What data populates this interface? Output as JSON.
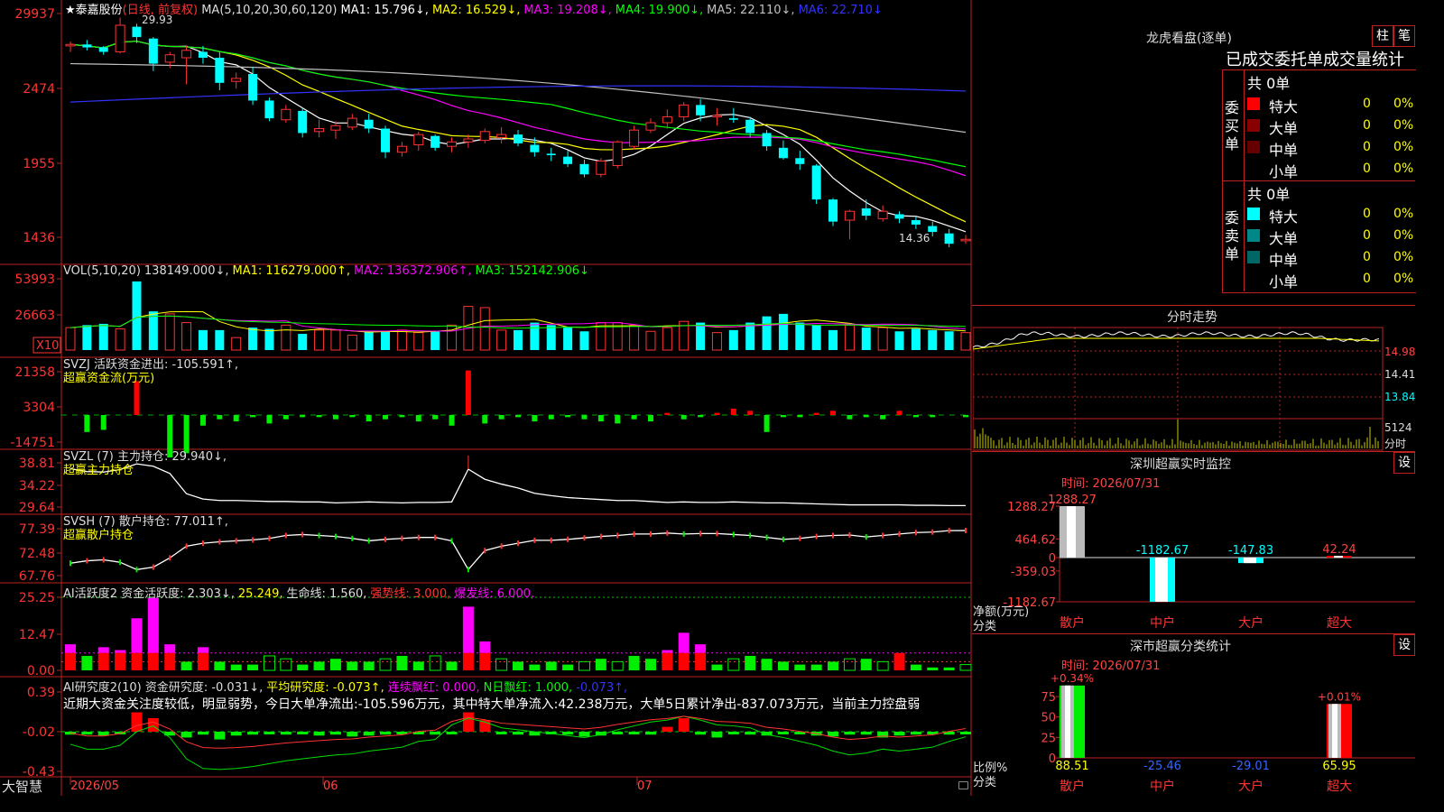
{
  "app": {
    "brand": "大智慧"
  },
  "stock": {
    "title": "★泰嘉股份",
    "mode": "(日线, 前复权)",
    "high_mark": "29.93",
    "low_mark": "14.36"
  },
  "ma_legend": {
    "label": "MA(5,10,20,30,60,120)",
    "items": [
      {
        "text": "MA1: 15.796↓,",
        "color": "#ffffff"
      },
      {
        "text": "MA2: 16.529↓,",
        "color": "#ffff00"
      },
      {
        "text": "MA3: 19.208↓,",
        "color": "#ff00ff"
      },
      {
        "text": "MA4: 19.900↓,",
        "color": "#00ff00"
      },
      {
        "text": "MA5: 22.110↓,",
        "color": "#c0c0c0"
      },
      {
        "text": "MA6: 22.710↓",
        "color": "#3333ff"
      }
    ]
  },
  "price_axis": [
    "29937",
    "2474",
    "1955",
    "1436"
  ],
  "vol": {
    "axis": [
      "53993",
      "26663",
      "X10"
    ],
    "legend": [
      {
        "text": "VOL(5,10,20)",
        "color": "#dddddd"
      },
      {
        "text": "138149.000↓,",
        "color": "#dddddd"
      },
      {
        "text": "MA1: 116279.000↑,",
        "color": "#ffff00"
      },
      {
        "text": "MA2: 136372.906↑,",
        "color": "#ff00ff"
      },
      {
        "text": "MA3: 152142.906↓",
        "color": "#00ff00"
      }
    ]
  },
  "svzj": {
    "axis": [
      "21358",
      "3304",
      "-14751"
    ],
    "line1": "SVZJ  活跃资金进出: -105.591↑,",
    "line2": "超赢资金流(万元)"
  },
  "svzl": {
    "axis": [
      "38.81",
      "34.22",
      "29.64"
    ],
    "line1": "SVZL (7) 主力持仓: 29.940↓,",
    "line2": "超赢主力持仓"
  },
  "svsh": {
    "axis": [
      "77.39",
      "72.48",
      "67.76"
    ],
    "line1": "SVSH (7) 散户持仓: 77.011↑,",
    "line2": "超赢散户持仓"
  },
  "ai_active": {
    "axis": [
      "25.25",
      "12.47",
      "0.00"
    ],
    "legend": [
      {
        "text": "AI活跃度2 资金活跃度: 2.303↓,",
        "color": "#dddddd"
      },
      {
        "text": "25.249,",
        "color": "#ffff00"
      },
      {
        "text": "生命线: 1.560,",
        "color": "#dddddd"
      },
      {
        "text": "强势线: 3.000,",
        "color": "#ff3333"
      },
      {
        "text": "爆发线: 6.000,",
        "color": "#ff00ff"
      }
    ]
  },
  "ai_research": {
    "axis": [
      "0.39",
      "-0.02",
      "-0.43"
    ],
    "legend": [
      {
        "text": "AI研究度2(10) 资金研究度: -0.031↓,",
        "color": "#dddddd"
      },
      {
        "text": "平均研究度: -0.073↑,",
        "color": "#ffff00"
      },
      {
        "text": "连续飘红: 0.000,",
        "color": "#ff00ff"
      },
      {
        "text": "N日飘红: 1.000,",
        "color": "#00ff00"
      },
      {
        "text": "-0.073↑,",
        "color": "#3333ff"
      }
    ],
    "commentary": "近期大资金关注度较低，明显弱势，今日大单净流出:-105.596万元，其中特大单净流入:42.238万元，大单5日累计净出-837.073万元，当前主力控盘弱"
  },
  "time_axis": [
    "2026/05",
    "06",
    "07"
  ],
  "dragon": {
    "title": "龙虎看盘(逐单)",
    "btn_column": "柱",
    "btn_grid": "笔",
    "stats_header": "已成交委托单成交量统计",
    "buy": {
      "side": "委买单",
      "total": "共 0单",
      "rows": [
        {
          "label": "特大",
          "count": "0",
          "pct": "0%",
          "color": "#ff0000"
        },
        {
          "label": "大单",
          "count": "0",
          "pct": "0%",
          "color": "#880000"
        },
        {
          "label": "中单",
          "count": "0",
          "pct": "0%",
          "color": "#660000"
        },
        {
          "label": "小单",
          "count": "0",
          "pct": "0%",
          "color": "#000000"
        }
      ]
    },
    "sell": {
      "side": "委卖单",
      "total": "共 0单",
      "rows": [
        {
          "label": "特大",
          "count": "0",
          "pct": "0%",
          "color": "#00ffff"
        },
        {
          "label": "大单",
          "count": "0",
          "pct": "0%",
          "color": "#008888"
        },
        {
          "label": "中单",
          "count": "0",
          "pct": "0%",
          "color": "#006666"
        },
        {
          "label": "小单",
          "count": "0",
          "pct": "0%",
          "color": "#000000"
        }
      ]
    }
  },
  "intraday": {
    "title": "分时走势",
    "price_labels": [
      "14.98",
      "14.41",
      "13.84"
    ],
    "vol_label": "5124",
    "vol_unit": "分时"
  },
  "sz_monitor": {
    "title": "深圳超赢实时监控",
    "btn": "设",
    "time": "时间: 2026/07/31",
    "yaxis": [
      "1288.27",
      "464.62",
      "0",
      "-359.03",
      "-1182.67"
    ],
    "unit": "净额(万元)",
    "category_label": "分类",
    "categories": [
      "散户",
      "中户",
      "大户",
      "超大"
    ],
    "value_labels": [
      "1288.27",
      "-1182.67",
      "-147.83",
      "42.24"
    ]
  },
  "sz_class": {
    "title": "深市超赢分类统计",
    "btn": "设",
    "time": "时间: 2026/07/31",
    "yaxis": [
      "75",
      "50",
      "25",
      "0"
    ],
    "unit": "比例%",
    "category_label": "分类",
    "categories": [
      "散户",
      "中户",
      "大户",
      "超大"
    ],
    "top_labels": [
      "+0.34%",
      "",
      "",
      "+0.01%"
    ],
    "bottom_labels": [
      "88.51",
      "-25.46",
      "-29.01",
      "65.95"
    ]
  },
  "chart_data": [
    {
      "type": "candlestick",
      "title": "泰嘉股份 (日线, 前复权)",
      "x_months": [
        "2026/05",
        "06",
        "07"
      ],
      "ylim": [
        14.0,
        30.5
      ],
      "candles": [
        [
          28.0,
          28.3,
          27.6,
          28.1
        ],
        [
          28.1,
          28.4,
          27.7,
          27.9
        ],
        [
          27.9,
          28.0,
          27.4,
          27.6
        ],
        [
          27.6,
          29.93,
          27.5,
          29.4
        ],
        [
          29.3,
          29.5,
          28.2,
          28.6
        ],
        [
          28.5,
          28.6,
          26.3,
          26.8
        ],
        [
          26.9,
          27.6,
          26.5,
          27.4
        ],
        [
          27.2,
          28.0,
          25.4,
          27.7
        ],
        [
          27.6,
          28.0,
          26.8,
          27.2
        ],
        [
          27.2,
          27.6,
          25.0,
          25.5
        ],
        [
          25.6,
          26.2,
          25.1,
          25.8
        ],
        [
          26.1,
          26.6,
          24.0,
          24.3
        ],
        [
          24.3,
          24.5,
          22.9,
          23.1
        ],
        [
          23.0,
          24.0,
          22.8,
          23.7
        ],
        [
          23.6,
          23.8,
          21.8,
          22.1
        ],
        [
          22.2,
          23.0,
          21.8,
          22.4
        ],
        [
          22.3,
          22.9,
          21.7,
          22.6
        ],
        [
          22.5,
          23.4,
          22.3,
          23.1
        ],
        [
          23.0,
          23.4,
          22.1,
          22.4
        ],
        [
          22.4,
          22.6,
          20.4,
          20.8
        ],
        [
          20.8,
          21.5,
          20.5,
          21.2
        ],
        [
          21.3,
          22.2,
          20.9,
          22.0
        ],
        [
          21.9,
          22.0,
          20.9,
          21.1
        ],
        [
          21.2,
          21.8,
          20.8,
          21.5
        ],
        [
          21.5,
          22.0,
          21.1,
          21.7
        ],
        [
          21.6,
          22.4,
          21.4,
          22.2
        ],
        [
          21.8,
          22.5,
          21.4,
          22.0
        ],
        [
          22.0,
          22.3,
          21.2,
          21.4
        ],
        [
          21.3,
          21.8,
          20.5,
          20.8
        ],
        [
          20.7,
          21.1,
          20.2,
          20.6
        ],
        [
          20.5,
          20.9,
          19.8,
          20.0
        ],
        [
          20.0,
          20.3,
          19.1,
          19.3
        ],
        [
          19.3,
          20.4,
          19.1,
          20.2
        ],
        [
          19.9,
          21.6,
          19.7,
          21.5
        ],
        [
          21.2,
          22.6,
          21.0,
          22.3
        ],
        [
          22.3,
          23.1,
          22.1,
          22.8
        ],
        [
          22.8,
          23.7,
          22.4,
          23.2
        ],
        [
          23.2,
          24.2,
          22.9,
          24.0
        ],
        [
          24.0,
          24.4,
          22.9,
          23.3
        ],
        [
          23.2,
          23.8,
          22.6,
          23.3
        ],
        [
          23.1,
          23.8,
          22.8,
          23.0
        ],
        [
          23.0,
          23.2,
          21.8,
          22.1
        ],
        [
          22.1,
          22.3,
          20.9,
          21.2
        ],
        [
          21.1,
          21.6,
          20.3,
          20.4
        ],
        [
          20.4,
          20.9,
          19.6,
          20.0
        ],
        [
          19.9,
          20.0,
          17.3,
          17.6
        ],
        [
          17.6,
          17.7,
          15.8,
          16.1
        ],
        [
          16.2,
          16.9,
          14.9,
          16.8
        ],
        [
          17.0,
          17.6,
          16.2,
          16.5
        ],
        [
          16.3,
          17.2,
          16.1,
          16.8
        ],
        [
          16.6,
          16.8,
          16.0,
          16.3
        ],
        [
          16.2,
          16.4,
          15.6,
          15.9
        ],
        [
          15.8,
          16.1,
          15.1,
          15.4
        ],
        [
          15.3,
          15.6,
          14.36,
          14.6
        ],
        [
          14.8,
          15.2,
          14.6,
          14.9
        ]
      ]
    },
    {
      "type": "bar",
      "title": "VOL(5,10,20)",
      "unit": "X10",
      "values": [
        18,
        20,
        21,
        17,
        55,
        31,
        29,
        22,
        16,
        16,
        10,
        18,
        17,
        20,
        13,
        16,
        16,
        12,
        15,
        15,
        16,
        14,
        15,
        20,
        35,
        34,
        16,
        16,
        22,
        20,
        18,
        15,
        22,
        22,
        20,
        15,
        18,
        23,
        22,
        14,
        16,
        22,
        27,
        29,
        22,
        20,
        16,
        20,
        18,
        18,
        15,
        17,
        16,
        15,
        14
      ]
    },
    {
      "type": "bar",
      "title": "SVZJ 活跃资金进出",
      "values": [
        0,
        -8,
        -7,
        0,
        16,
        0,
        -20,
        -18,
        -5,
        -2,
        -3,
        -1,
        -4,
        -2,
        -1,
        -1,
        -2,
        -1,
        -3,
        -2,
        -1,
        -3,
        -2,
        -5,
        21,
        -4,
        -2,
        -1,
        -3,
        -2,
        -1,
        -2,
        -3,
        -4,
        -2,
        -3,
        1,
        -2,
        -1,
        1,
        3,
        2,
        -8,
        -1,
        -1,
        1,
        2,
        -2,
        -1,
        -2,
        2,
        -1,
        -1,
        0,
        -1
      ]
    },
    {
      "type": "line",
      "title": "SVZL 主力持仓",
      "values": [
        37.6,
        37.0,
        36.9,
        37.4,
        38.6,
        38.1,
        36.6,
        32.4,
        31.3,
        31.0,
        31.0,
        30.9,
        30.8,
        30.8,
        30.7,
        30.7,
        30.5,
        30.6,
        30.7,
        30.6,
        30.5,
        30.6,
        30.6,
        30.7,
        37.5,
        35.4,
        34.4,
        33.6,
        32.5,
        32.0,
        31.6,
        31.4,
        31.2,
        31.0,
        31.0,
        30.8,
        30.6,
        30.7,
        30.6,
        30.6,
        30.7,
        30.6,
        30.5,
        30.5,
        30.4,
        30.3,
        30.2,
        30.1,
        30.1,
        30.1,
        30.1,
        30.0,
        30.0,
        29.94,
        29.94
      ]
    },
    {
      "type": "line",
      "title": "SVSH 散户持仓",
      "values": [
        70.3,
        70.8,
        71.0,
        70.5,
        69.0,
        69.5,
        71.4,
        73.8,
        74.4,
        74.7,
        74.9,
        75.1,
        75.4,
        76.0,
        76.2,
        76.0,
        75.8,
        75.4,
        74.9,
        75.2,
        75.4,
        75.6,
        75.6,
        74.9,
        69.0,
        72.9,
        73.8,
        74.4,
        75.0,
        75.0,
        75.2,
        75.5,
        75.8,
        76.0,
        76.3,
        76.3,
        76.5,
        76.3,
        76.4,
        76.4,
        76.2,
        76.0,
        75.6,
        75.2,
        75.4,
        75.8,
        76.0,
        76.1,
        75.7,
        76.0,
        76.3,
        76.6,
        76.7,
        77.0,
        77.01
      ]
    },
    {
      "type": "bar",
      "title": "AI活跃度2 资金活跃度",
      "life_line": 1.56,
      "strong_line": 3.0,
      "burst_line": 6.0,
      "top_line": 25.249,
      "values": [
        9,
        5,
        8,
        7,
        18,
        25,
        9,
        3,
        8,
        3,
        2,
        2,
        5,
        4,
        2,
        3,
        4,
        3,
        3,
        4,
        5,
        3,
        5,
        3,
        22,
        10,
        4,
        3,
        2,
        3,
        2,
        3,
        4,
        3,
        5,
        4,
        7,
        13,
        9,
        2,
        4,
        5,
        4,
        3,
        2,
        2,
        3,
        4,
        4,
        3,
        6,
        2,
        1,
        1,
        2
      ]
    },
    {
      "type": "bar",
      "title": "AI研究度2(10) 资金研究度",
      "values": [
        -0.05,
        -0.05,
        -0.06,
        -0.04,
        0.18,
        0.12,
        -0.06,
        -0.08,
        -0.05,
        -0.1,
        -0.06,
        -0.05,
        -0.04,
        -0.05,
        -0.04,
        -0.06,
        -0.05,
        -0.07,
        -0.06,
        -0.05,
        -0.04,
        -0.03,
        -0.05,
        -0.04,
        0.18,
        0.1,
        -0.04,
        -0.05,
        -0.06,
        -0.04,
        -0.05,
        -0.07,
        -0.06,
        -0.04,
        -0.03,
        -0.05,
        0.03,
        0.12,
        -0.05,
        -0.08,
        -0.04,
        -0.05,
        -0.06,
        -0.04,
        -0.03,
        -0.06,
        -0.07,
        -0.05,
        -0.05,
        -0.08,
        -0.06,
        -0.05,
        -0.04,
        -0.05,
        -0.031
      ],
      "avg_line": [
        -0.15,
        -0.2,
        -0.2,
        -0.16,
        -0.02,
        0.04,
        -0.08,
        -0.3,
        -0.4,
        -0.41,
        -0.4,
        -0.38,
        -0.35,
        -0.32,
        -0.3,
        -0.28,
        -0.26,
        -0.25,
        -0.22,
        -0.2,
        -0.18,
        -0.12,
        -0.1,
        0.05,
        0.12,
        0.08,
        0.02,
        0.0,
        -0.02,
        -0.04,
        -0.06,
        -0.08,
        -0.05,
        0.0,
        0.04,
        0.08,
        0.1,
        0.14,
        0.1,
        0.05,
        0.04,
        0.02,
        -0.05,
        -0.08,
        -0.12,
        -0.16,
        -0.22,
        -0.26,
        -0.24,
        -0.2,
        -0.22,
        -0.2,
        -0.18,
        -0.12,
        -0.073
      ]
    },
    {
      "type": "bar",
      "title": "深圳超赢实时监控",
      "categories": [
        "散户",
        "中户",
        "大户",
        "超大"
      ],
      "values": [
        1288.27,
        -1182.67,
        -147.83,
        42.24
      ],
      "ylim": [
        -1182.67,
        1288.27
      ]
    },
    {
      "type": "bar",
      "title": "深市超赢分类统计",
      "categories": [
        "散户",
        "中户",
        "大户",
        "超大"
      ],
      "values": [
        88.51,
        -25.46,
        -29.01,
        65.95
      ],
      "ylim": [
        0,
        75
      ]
    }
  ]
}
